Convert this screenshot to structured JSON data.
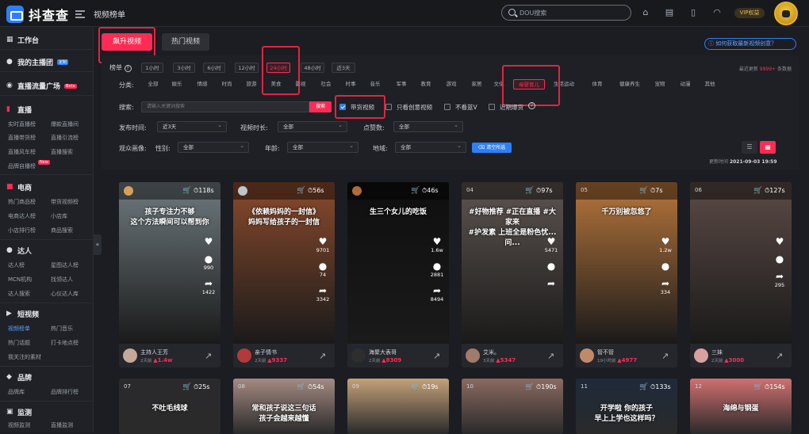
{
  "app": {
    "logo_text": "抖查查",
    "page_title": "视频榜单",
    "search_placeholder": "DOU搜索",
    "vip_label": "VIP权益"
  },
  "sidebar": {
    "sections": [
      {
        "title": "工作台",
        "icon": "grid-icon"
      },
      {
        "title": "我的主播团",
        "icon": "user-group-icon",
        "badge": "定制"
      },
      {
        "title": "直播流量广场",
        "icon": "broadcast-icon",
        "badge": "Beta"
      },
      {
        "title": "直播",
        "icon": "bar-chart-icon"
      },
      {
        "title": "电商",
        "icon": "shopping-bag-icon"
      },
      {
        "title": "达人",
        "icon": "person-icon"
      },
      {
        "title": "短视频",
        "icon": "video-icon"
      },
      {
        "title": "品牌",
        "icon": "tag-icon"
      },
      {
        "title": "监测",
        "icon": "monitor-icon"
      }
    ],
    "live_items": [
      "实时直播榜",
      "爆款直播间",
      "直播带货榜",
      "直播引流榜",
      "直播风车榜",
      "直播搜索",
      "品牌自播榜"
    ],
    "live_new_badge": "New",
    "ecom_items": [
      "热门商品榜",
      "带货视频榜",
      "电商达人榜",
      "小店库",
      "小店排行榜",
      "商品搜索"
    ],
    "kol_items": [
      "达人榜",
      "星图达人榜",
      "MCN机构",
      "找领达人",
      "达人搜索",
      "心仪达人库"
    ],
    "video_items": [
      "视频榜单",
      "热门音乐",
      "热门话题",
      "打卡地点榜",
      "我关注的素材"
    ],
    "brand_items": [
      "品牌库",
      "品牌排行榜"
    ],
    "monitor_items": [
      "视频监测",
      "直播监测"
    ],
    "collapse_glyph": "«"
  },
  "tabs": {
    "active": "飙升视频",
    "inactive": "热门视频"
  },
  "help_link": "如何获取最新视频创意？",
  "filters": {
    "rank_label": "榜单",
    "rank_help": "?",
    "time_ranges": [
      "1小时",
      "3小时",
      "6小时",
      "12小时",
      "24小时",
      "48小时",
      "近3天"
    ],
    "selected_time_range": "24小时",
    "update_note_prefix": "最近更新",
    "update_count": "9999+",
    "update_note_suffix": "条数据",
    "category_label": "分类:",
    "categories": [
      "全部",
      "娱乐",
      "情感",
      "时尚",
      "旅游",
      "美食",
      "影视",
      "社会",
      "时事",
      "音乐",
      "军事",
      "教育",
      "游戏",
      "家居",
      "文化",
      "母婴育儿",
      "生活运动",
      "体育",
      "健康养生",
      "宠物",
      "动漫",
      "其他"
    ],
    "selected_category": "母婴育儿",
    "search_label": "搜索:",
    "keyword_placeholder": "请输入关键词搜索",
    "search_button": "搜索",
    "checkbox_goods": "带货视频",
    "checkbox_creative": "只看创意视频",
    "checkbox_blue_v": "不看蓝V",
    "checkbox_sold": "近期爆货",
    "publish_time_label": "发布时间:",
    "publish_time_value": "近3天",
    "duration_label": "视频时长:",
    "duration_value": "全部",
    "likes_label": "点赞数:",
    "likes_value": "全部",
    "audience_label": "观众画像:",
    "gender_label": "性别:",
    "gender_value": "全部",
    "age_label": "年龄:",
    "age_value": "全部",
    "region_label": "地域:",
    "region_value": "全部",
    "clear_button": "清空所选",
    "update_time_label": "更新时间",
    "update_time_value": "2021-09-03 19:59"
  },
  "videos": [
    {
      "rank": "",
      "medal": "#d4a15a",
      "duration": "118s",
      "caption": "孩子专注力不够\n这个方法瞬间可以帮到你",
      "likes": "",
      "comments": "990",
      "shares": "1422",
      "author": "主持人王芳",
      "days": "2天前",
      "growth": "1.4w",
      "cover": "#6f7a7f",
      "avatar": "#c2a999"
    },
    {
      "rank": "",
      "medal": "#c0c4cc",
      "duration": "56s",
      "caption": "《依赖妈妈的一封信》\n妈妈写给孩子的一封信",
      "likes": "9701",
      "comments": "74",
      "shares": "3342",
      "author": "亲子情书",
      "days": "2天前",
      "growth": "9337",
      "cover": "#8a4a2c",
      "avatar": "#b13a3a"
    },
    {
      "rank": "",
      "medal": "#b06a3a",
      "duration": "46s",
      "caption": "生三个女儿的吃饭",
      "likes": "1.6w",
      "comments": "2881",
      "shares": "8494",
      "author": "海聚大表哥",
      "days": "2天前",
      "growth": "8309",
      "cover": "#0f0f10",
      "avatar": "#2e2e2e"
    },
    {
      "rank": "04",
      "medal": "",
      "duration": "97s",
      "caption": "#好物推荐 #正在直播 #大家来\n#护发素 上班全是粉色忧...问...",
      "likes": "5471",
      "comments": "",
      "shares": "",
      "author": "艾米。",
      "days": "3天前",
      "growth": "5347",
      "cover": "#5d5450",
      "avatar": "#a07a6a"
    },
    {
      "rank": "05",
      "medal": "",
      "duration": "7s",
      "caption": "千万别被忽悠了",
      "likes": "1.2w",
      "comments": "",
      "shares": "334",
      "author": "管不管",
      "days": "19小时前",
      "growth": "4977",
      "cover": "#b8763c",
      "avatar": "#c08a6a"
    },
    {
      "rank": "06",
      "medal": "",
      "duration": "127s",
      "caption": "",
      "likes": "",
      "comments": "",
      "shares": "295",
      "author": "三妹",
      "days": "2天前",
      "growth": "3000",
      "cover": "#5b4a45",
      "avatar": "#d9a0a0"
    }
  ],
  "videos_row2": [
    {
      "rank": "07",
      "duration": "25s",
      "caption": "不吐毛线球",
      "cover": "#2a2a2d"
    },
    {
      "rank": "08",
      "duration": "54s",
      "caption": "常和孩子说这三句话\n孩子会越来越懂",
      "cover": "#a48a82"
    },
    {
      "rank": "09",
      "duration": "19s",
      "caption": "",
      "cover": "#c4a27a"
    },
    {
      "rank": "10",
      "duration": "190s",
      "caption": "",
      "cover": "#8a6a60"
    },
    {
      "rank": "11",
      "duration": "133s",
      "caption": "开学啦 你的孩子\n早上上学也这样吗？",
      "cover": "#1e2a3a"
    },
    {
      "rank": "12",
      "duration": "154s",
      "caption": "海绵与钢蛋",
      "cover": "#d07070"
    }
  ]
}
